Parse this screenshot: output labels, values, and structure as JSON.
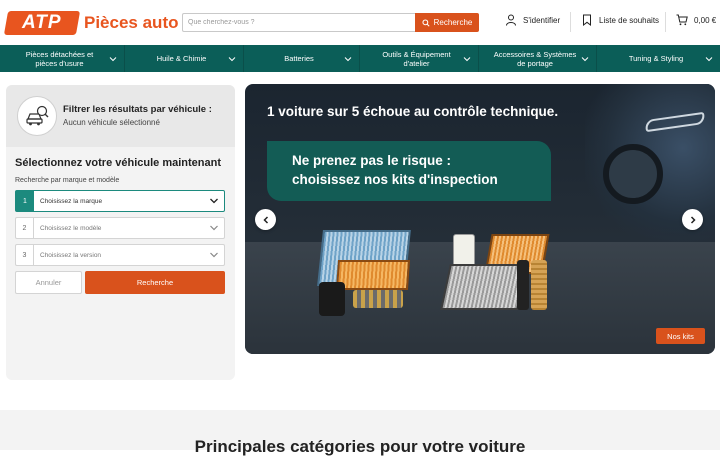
{
  "header": {
    "logo_badge": "ATP",
    "logo_text": "Pièces auto",
    "search_placeholder": "Que cherchez-vous ?",
    "search_button": "Recherche",
    "login_label": "S'identifier",
    "wishlist_label": "Liste de souhaits",
    "cart_total": "0,00 €"
  },
  "nav": {
    "items": [
      {
        "label": "Pièces détachées et pièces d'usure"
      },
      {
        "label": "Huile & Chimie"
      },
      {
        "label": "Batteries"
      },
      {
        "label": "Outils & Équipement d'atelier"
      },
      {
        "label": "Accessoires & Systèmes de portage"
      },
      {
        "label": "Tuning & Styling"
      }
    ]
  },
  "vehicle_filter": {
    "title": "Filtrer les résultats par véhicule :",
    "status": "Aucun véhicule sélectionné",
    "heading": "Sélectionnez votre véhicule maintenant",
    "subheading": "Recherche par marque et modèle",
    "steps": [
      {
        "num": "1",
        "placeholder": "Choisissez la marque"
      },
      {
        "num": "2",
        "placeholder": "Choisissez le modèle"
      },
      {
        "num": "3",
        "placeholder": "Choisissez la version"
      }
    ],
    "cancel_label": "Annuler",
    "search_label": "Recherche"
  },
  "banner": {
    "headline": "1 voiture sur 5 échoue au contrôle technique.",
    "box_line1": "Ne prenez pas le risque :",
    "box_line2": "choisissez nos kits d'inspection",
    "cta": "Nos kits"
  },
  "section": {
    "title": "Principales catégories pour votre voiture"
  },
  "colors": {
    "brand_orange": "#d9521c",
    "nav_teal": "#0b5e58",
    "accent_teal": "#1c8a7e"
  }
}
